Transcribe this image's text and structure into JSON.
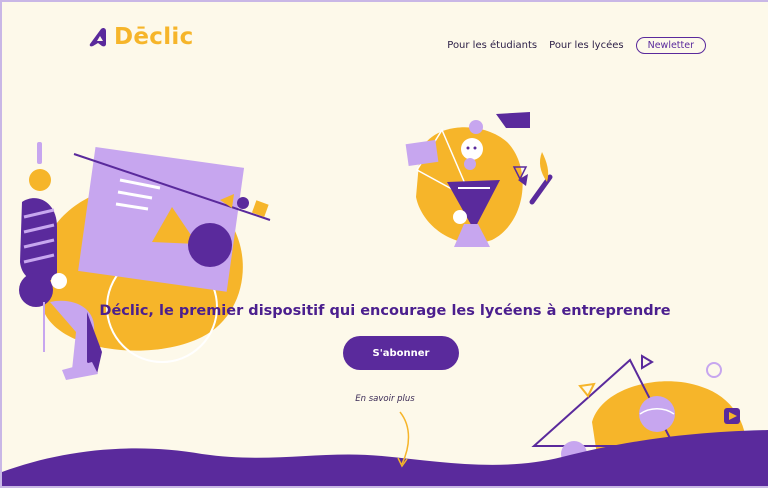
{
  "header": {
    "logo_text": "Dēclic",
    "nav": {
      "students": "Pour les étudiants",
      "highschools": "Pour les lycées",
      "newsletter": "Newletter"
    }
  },
  "hero": {
    "title": "Déclic, le premier dispositif qui encourage les lycéens à entreprendre",
    "cta_label": "S'abonner",
    "more_label": "En savoir plus"
  },
  "colors": {
    "background": "#fdf9ea",
    "purple": "#5a2a9c",
    "lavender": "#c7a6ef",
    "yellow": "#f6b52a"
  }
}
